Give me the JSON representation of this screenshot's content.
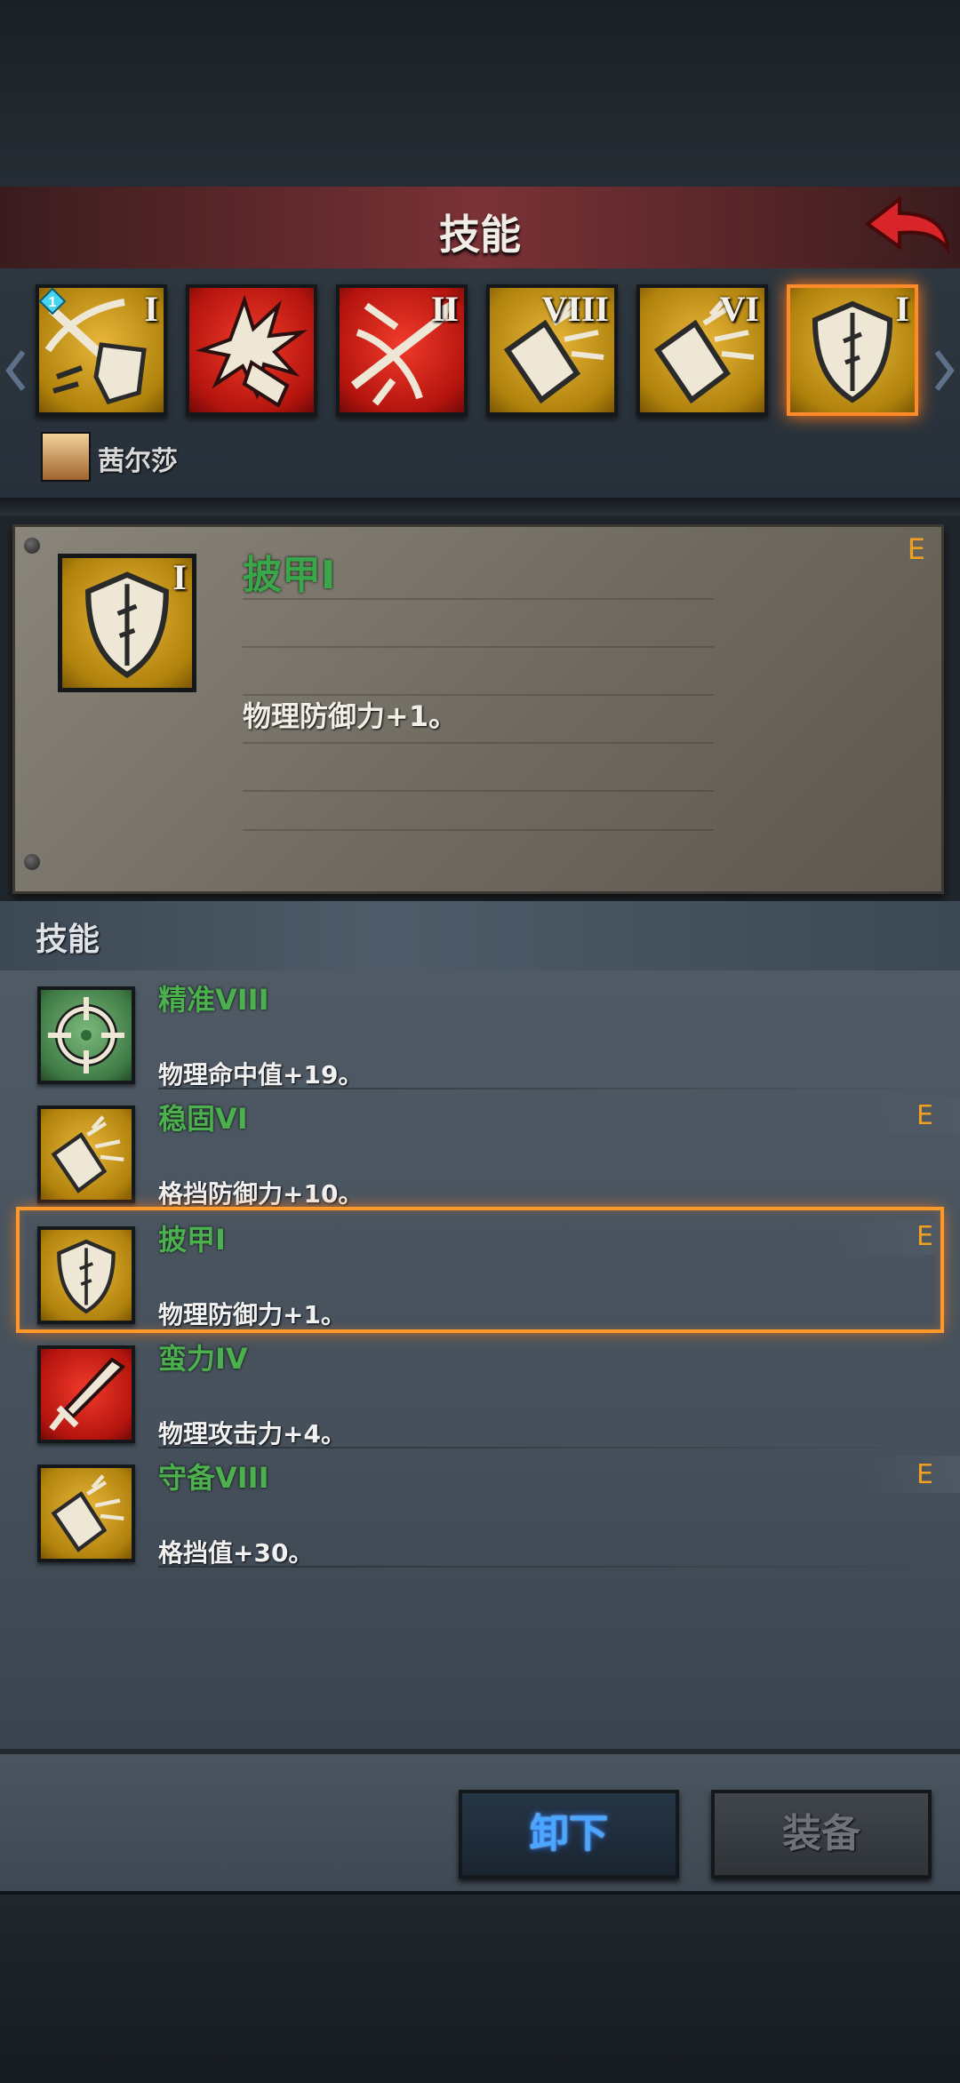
{
  "header": {
    "title": "技能",
    "back_icon": "back-arrow-icon"
  },
  "strip": {
    "slots": [
      {
        "icon": "crossbow-shield-icon",
        "roman": "I",
        "color": "gold",
        "badge": "1"
      },
      {
        "icon": "smash-fist-icon",
        "roman": "",
        "color": "red"
      },
      {
        "icon": "crossbow-icon",
        "roman": "II",
        "color": "red"
      },
      {
        "icon": "block-shield-icon",
        "roman": "VIII",
        "color": "gold"
      },
      {
        "icon": "block-shield-icon",
        "roman": "VI",
        "color": "gold"
      },
      {
        "icon": "shield-icon",
        "roman": "I",
        "color": "gold",
        "selected": true
      }
    ],
    "hero_name": "茜尔莎"
  },
  "detail": {
    "title": "披甲I",
    "roman": "I",
    "description": "物理防御力+1。",
    "equipped_mark": "E"
  },
  "section": {
    "title": "技能"
  },
  "skills": [
    {
      "name": "精准VIII",
      "desc": "物理命中值+19。",
      "icon": "crosshair-icon",
      "equipped": ""
    },
    {
      "name": "稳固VI",
      "desc": "格挡防御力+10。",
      "icon": "block-shield-icon",
      "equipped": "E"
    },
    {
      "name": "披甲I",
      "desc": "物理防御力+1。",
      "icon": "shield-icon",
      "equipped": "E",
      "selected": true
    },
    {
      "name": "蛮力IV",
      "desc": "物理攻击力+4。",
      "icon": "sword-icon",
      "equipped": ""
    },
    {
      "name": "守备VIII",
      "desc": "格挡值+30。",
      "icon": "block-shield-icon",
      "equipped": "E"
    }
  ],
  "buttons": {
    "unequip": "卸下",
    "equip": "装备"
  },
  "colors": {
    "accent_orange": "#ff8a2a",
    "skill_green": "#4cb04e",
    "equip_mark": "#f0a020"
  }
}
